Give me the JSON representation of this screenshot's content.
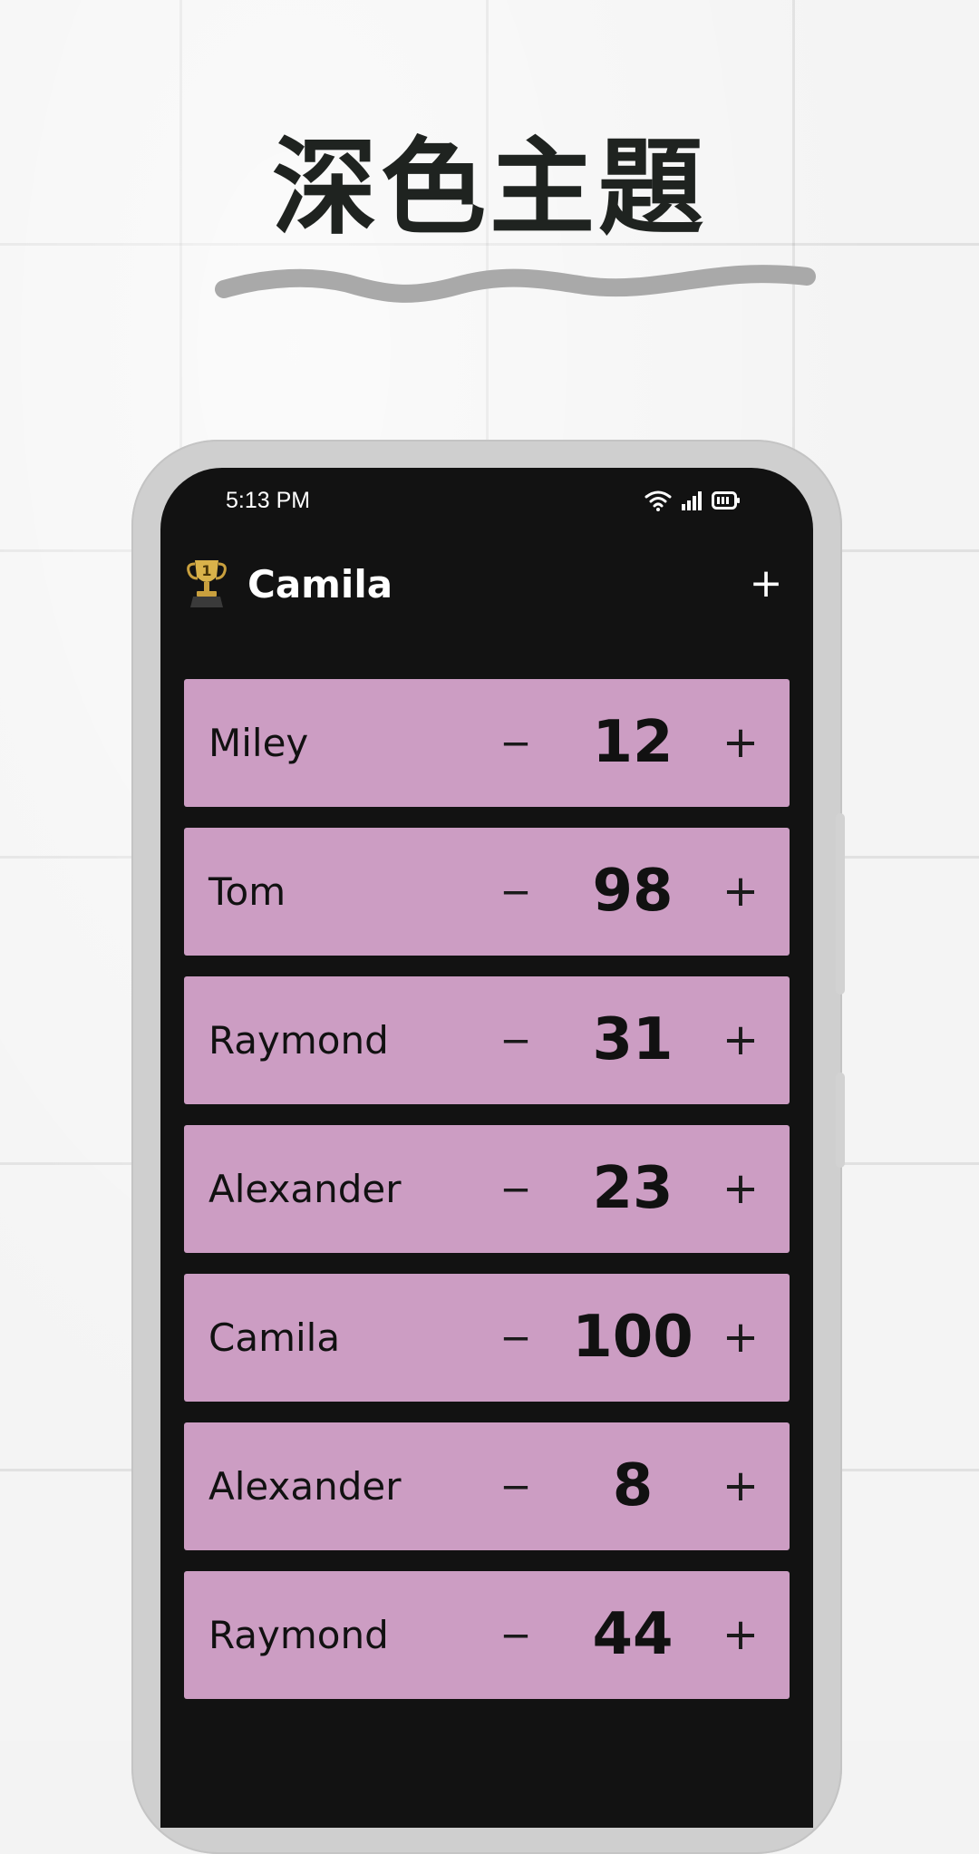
{
  "headline": "深色主題",
  "status_bar": {
    "time": "5:13 PM",
    "icons": [
      "wifi-icon",
      "signal-icon",
      "battery-icon"
    ]
  },
  "app_bar": {
    "leader_icon": "trophy-first-place-icon",
    "leader_name": "Camila",
    "add_label": "+"
  },
  "colors": {
    "card": "#cc9dc3",
    "screen_background": "#121212",
    "page_background": "#f4f4f4",
    "headline": "#1f2320"
  },
  "controls": {
    "decrement": "−",
    "increment": "+"
  },
  "players": [
    {
      "name": "Miley",
      "score": "12"
    },
    {
      "name": "Tom",
      "score": "98"
    },
    {
      "name": "Raymond",
      "score": "31"
    },
    {
      "name": "Alexander",
      "score": "23"
    },
    {
      "name": "Camila",
      "score": "100"
    },
    {
      "name": "Alexander",
      "score": "8"
    },
    {
      "name": "Raymond",
      "score": "44"
    }
  ]
}
